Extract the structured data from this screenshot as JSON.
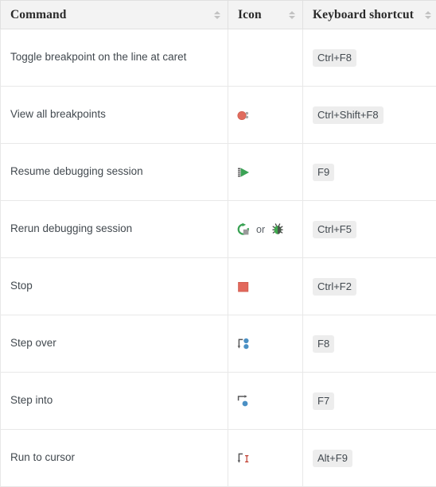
{
  "table": {
    "columns": [
      {
        "label": "Command",
        "sortable": true,
        "sort_state": "none"
      },
      {
        "label": "Icon",
        "sortable": true,
        "sort_state": "none"
      },
      {
        "label": "Keyboard shortcut",
        "sortable": true,
        "sort_state": "none"
      }
    ],
    "separator_word": "or",
    "rows": [
      {
        "command": "Toggle breakpoint on the line at caret",
        "icons": [],
        "shortcut": "Ctrl+F8"
      },
      {
        "command": "View all breakpoints",
        "icons": [
          "view-breakpoints-icon"
        ],
        "shortcut": "Ctrl+Shift+F8"
      },
      {
        "command": "Resume debugging session",
        "icons": [
          "resume-program-icon"
        ],
        "shortcut": "F9"
      },
      {
        "command": "Rerun debugging session",
        "icons": [
          "rerun-icon",
          "debug-bug-icon"
        ],
        "shortcut": "Ctrl+F5"
      },
      {
        "command": "Stop",
        "icons": [
          "stop-icon"
        ],
        "shortcut": "Ctrl+F2"
      },
      {
        "command": "Step over",
        "icons": [
          "step-over-icon"
        ],
        "shortcut": "F8"
      },
      {
        "command": "Step into",
        "icons": [
          "step-into-icon"
        ],
        "shortcut": "F7"
      },
      {
        "command": "Run to cursor",
        "icons": [
          "run-to-cursor-icon"
        ],
        "shortcut": "Alt+F9"
      }
    ]
  },
  "colors": {
    "header_background": "#f3f3f3",
    "border": "#e0e0e0",
    "row_border": "#e8e8e8",
    "text": "#42494f",
    "kbd_background": "#ededed",
    "breakpoint_red": "#e06c5e",
    "stop_red": "#e2685c",
    "resume_green": "#3aa254",
    "rerun_green": "#3aa254",
    "bug_green": "#3fa94e",
    "step_blue": "#4a90c4",
    "arrow_gray": "#58585a",
    "cursor_red": "#c0392b",
    "sort_arrow_gray": "#c2c2c2"
  }
}
